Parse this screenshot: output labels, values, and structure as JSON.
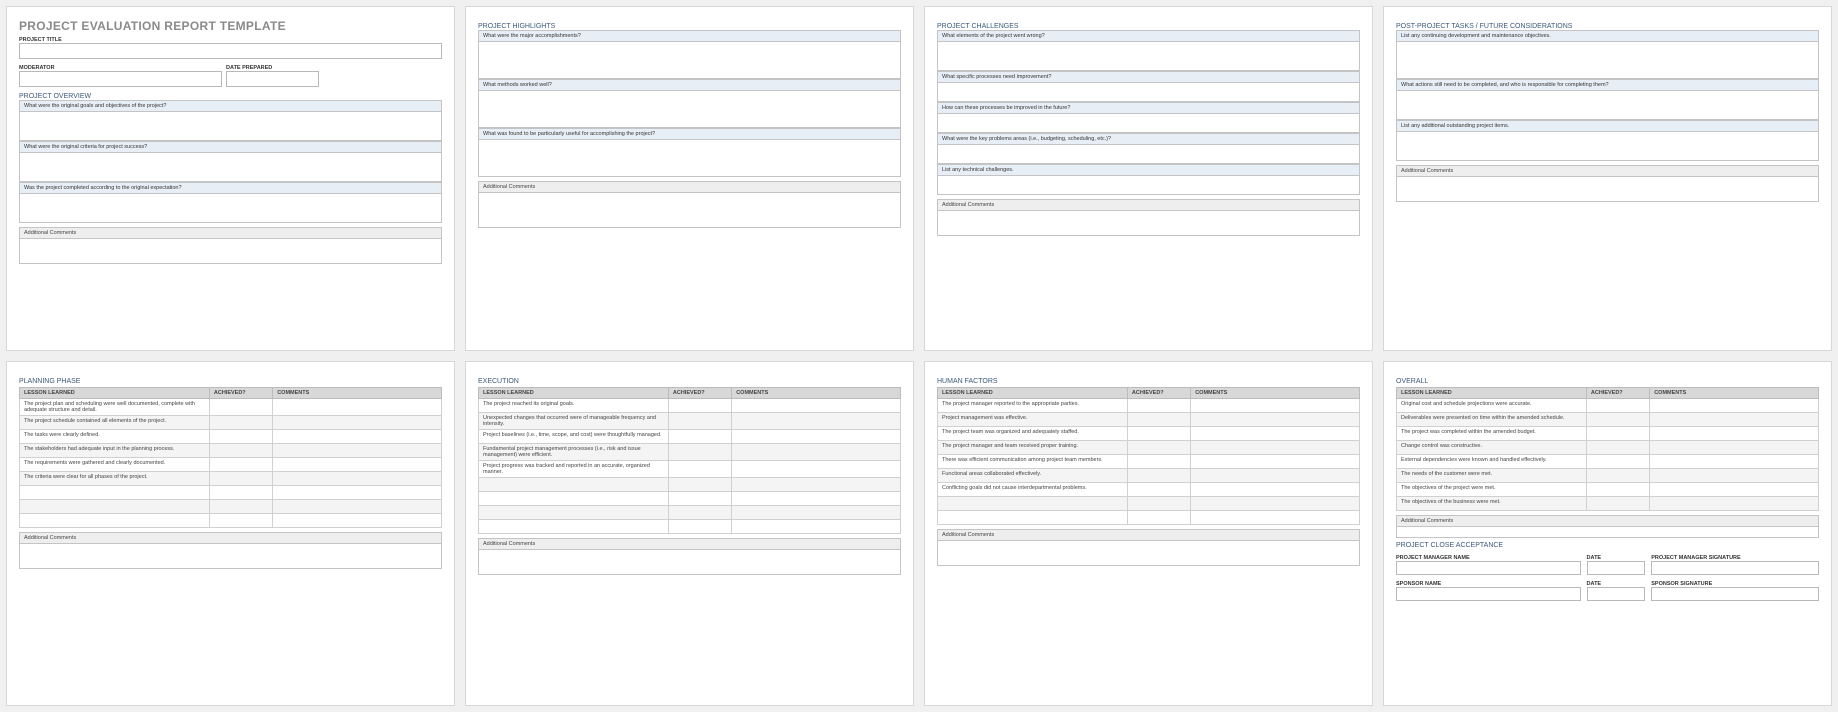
{
  "page1": {
    "title": "PROJECT EVALUATION REPORT TEMPLATE",
    "projectTitleLabel": "PROJECT TITLE",
    "moderatorLabel": "MODERATOR",
    "datePreparedLabel": "DATE PREPARED",
    "overviewTitle": "PROJECT OVERVIEW",
    "q1": "What were the original goals and objectives of the project?",
    "q2": "What were the original criteria for project success?",
    "q3": "Was the project completed according to the original expectation?",
    "addl": "Additional Comments"
  },
  "page2": {
    "title": "PROJECT HIGHLIGHTS",
    "q1": "What were the major accomplishments?",
    "q2": "What methods worked well?",
    "q3": "What was found to be particularly useful for accomplishing the project?",
    "addl": "Additional Comments"
  },
  "page3": {
    "title": "PROJECT CHALLENGES",
    "q1": "What elements of the project went wrong?",
    "q2": "What specific processes need improvement?",
    "q3": "How can these processes be improved in the future?",
    "q4": "What were the key problems areas (i.e., budgeting, scheduling, etc.)?",
    "q5": "List any technical challenges.",
    "addl": "Additional Comments"
  },
  "page4": {
    "title": "POST-PROJECT TASKS / FUTURE CONSIDERATIONS",
    "q1": "List any continuing development and maintenance objectives.",
    "q2": "What actions still need to be completed, and who is responsible for completing them?",
    "q3": "List any additional outstanding project items.",
    "addl": "Additional Comments"
  },
  "lessonsHeaders": {
    "c1": "LESSON LEARNED",
    "c2": "ACHIEVED?",
    "c3": "COMMENTS"
  },
  "page5": {
    "title": "PLANNING PHASE",
    "rows": [
      "The project plan and scheduling were well documented, complete with adequate structure and detail.",
      "The project schedule contained all elements of the project.",
      "The tasks were clearly defined.",
      "The stakeholders had adequate input in the planning process.",
      "The requirements were gathered and clearly documented.",
      "The criteria were clear for all phases of the project.",
      "",
      "",
      ""
    ],
    "addl": "Additional Comments"
  },
  "page6": {
    "title": "EXECUTION",
    "rows": [
      "The project reached its original goals.",
      "Unexpected changes that occurred were of manageable frequency and intensity.",
      "Project baselines (i.e., time, scope, and cost) were thoughtfully managed.",
      "Fundamental project management processes (i.e., risk and issue management) were efficient.",
      "Project progress was tracked and reported in an accurate, organized manner.",
      "",
      "",
      "",
      ""
    ],
    "addl": "Additional Comments"
  },
  "page7": {
    "title": "HUMAN FACTORS",
    "rows": [
      "The project manager reported to the appropriate parties.",
      "Project management was effective.",
      "The project team was organized and adequately staffed.",
      "The project manager and team received proper training.",
      "There was efficient communication among project team members.",
      "Functional areas collaborated effectively.",
      "Conflicting goals did not cause interdepartmental problems.",
      "",
      ""
    ],
    "addl": "Additional Comments"
  },
  "page8": {
    "title": "OVERALL",
    "rows": [
      "Original cost and schedule projections were accurate.",
      "Deliverables were presented on time within the amended schedule.",
      "The project was completed within the amended budget.",
      "Change control was constructive.",
      "External dependencies were known and handled effectively.",
      "The needs of the customer were met.",
      "The objectives of the project were met.",
      "The objectives of the business were met."
    ],
    "addl": "Additional Comments",
    "closeTitle": "PROJECT CLOSE ACCEPTANCE",
    "pmName": "PROJECT MANAGER NAME",
    "date": "DATE",
    "pmSig": "PROJECT MANAGER SIGNATURE",
    "spName": "SPONSOR NAME",
    "spSig": "SPONSOR SIGNATURE"
  }
}
